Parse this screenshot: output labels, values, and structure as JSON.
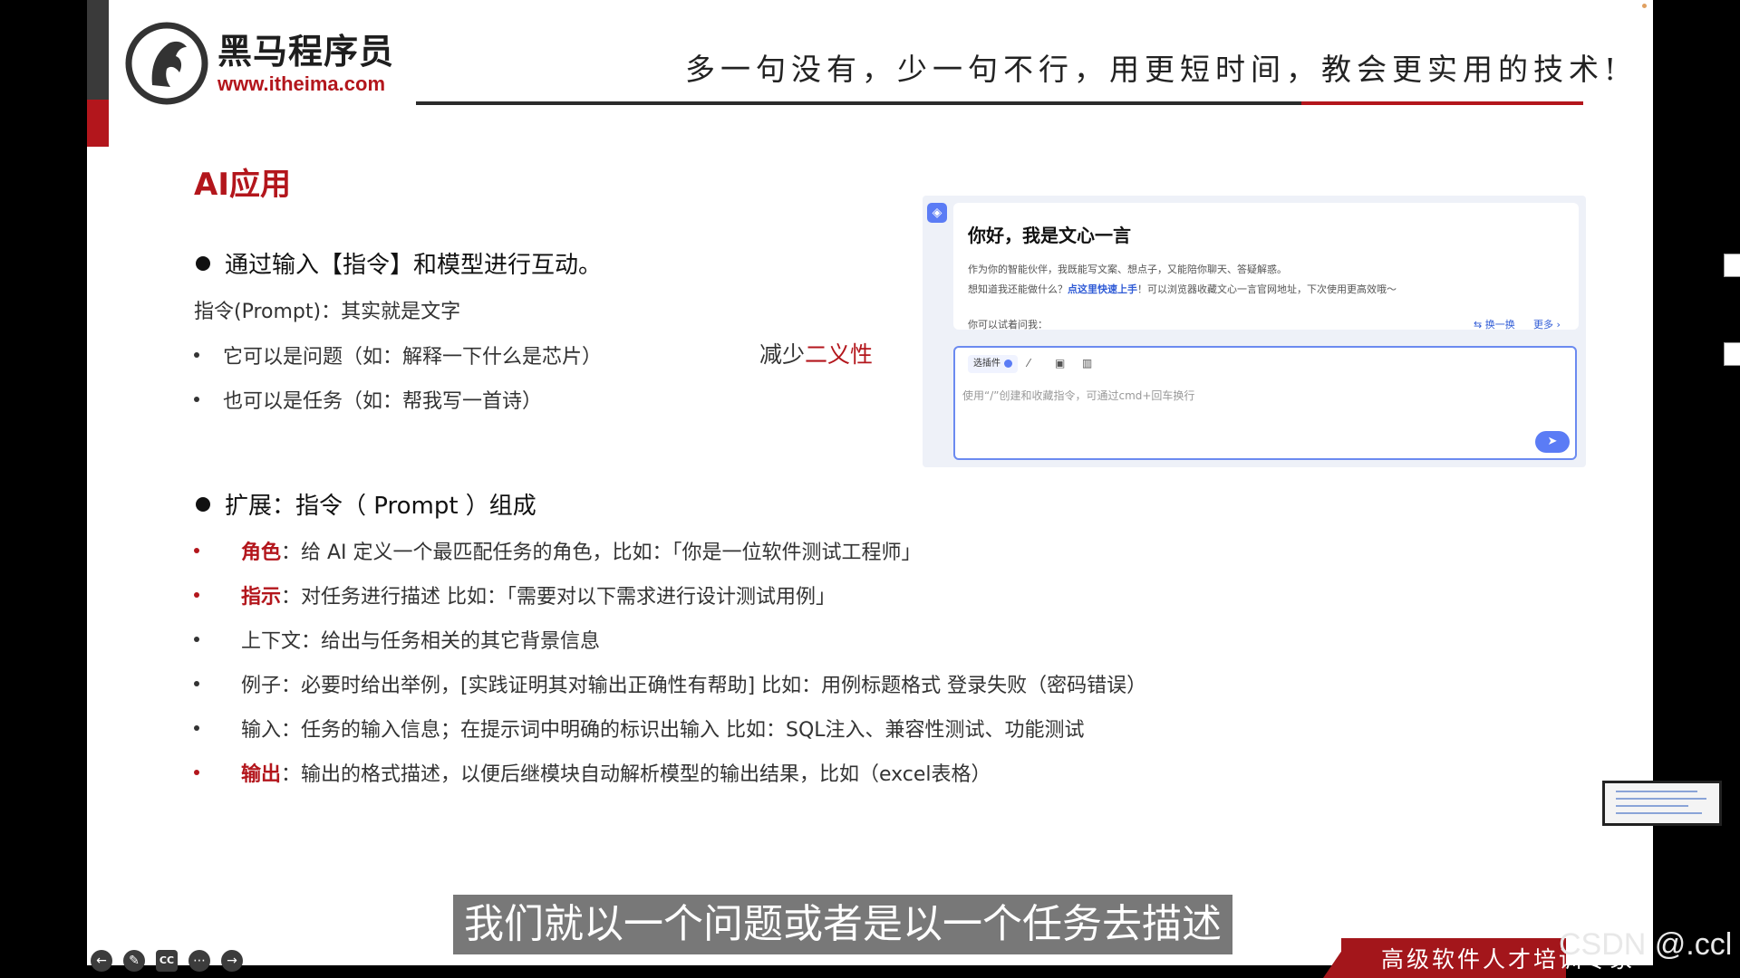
{
  "header": {
    "logo_cn": "黑马程序员",
    "logo_url": "www.itheima.com",
    "slogan": "多一句没有，少一句不行，用更短时间，教会更实用的技术!"
  },
  "slide": {
    "section_title": "AI应用",
    "point1": "通过输入【指令】和模型进行互动。",
    "prompt_def": "指令(Prompt)：其实就是文字",
    "sub1": "它可以是问题（如：解释一下什么是芯片）",
    "sub2": "也可以是任务（如：帮我写一首诗）",
    "reduce_prefix": "减少",
    "reduce_highlight": "二义性",
    "point2": "扩展：指令（ Prompt ）组成",
    "items": [
      {
        "key": "角色",
        "text": "：给 AI 定义一个最匹配任务的角色，比如：「你是一位软件测试工程师」"
      },
      {
        "key": "指示",
        "text": "：对任务进行描述 比如：「需要对以下需求进行设计测试用例」"
      },
      {
        "key": "上下文",
        "text": "：给出与任务相关的其它背景信息"
      },
      {
        "key": "例子",
        "text": "：必要时给出举例，[实践证明其对输出正确性有帮助] 比如：用例标题格式 登录失败（密码错误）"
      },
      {
        "key": "输入",
        "text": "：任务的输入信息；在提示词中明确的标识出输入 比如：SQL注入、兼容性测试、功能测试"
      },
      {
        "key": "输出",
        "text": "：输出的格式描述，以便后继模块自动解析模型的输出结果，比如（excel表格）"
      }
    ]
  },
  "chat": {
    "title": "你好，我是文心一言",
    "desc1": "作为你的智能伙伴，我既能写文案、想点子，又能陪你聊天、答疑解惑。",
    "desc2_prefix": "想知道我还能做什么？",
    "desc2_link": "点这里快速上手",
    "desc2_suffix": "！可以浏览器收藏文心一言官网地址，下次使用更高效哦～",
    "try_label": "你可以试着问我：",
    "swap_label": "⇆ 换一换",
    "more_label": "更多 ›",
    "plugin_label": "选插件",
    "placeholder": "使用“/”创建和收藏指令，可通过cmd+回车换行"
  },
  "subtitle": "我们就以一个问题或者是以一个任务去描述",
  "banner": "高级软件人才培训专家",
  "watermark": "CSDN @.ccl",
  "colors": {
    "brand_red": "#b3161c",
    "accent_blue": "#5b7cf5"
  }
}
